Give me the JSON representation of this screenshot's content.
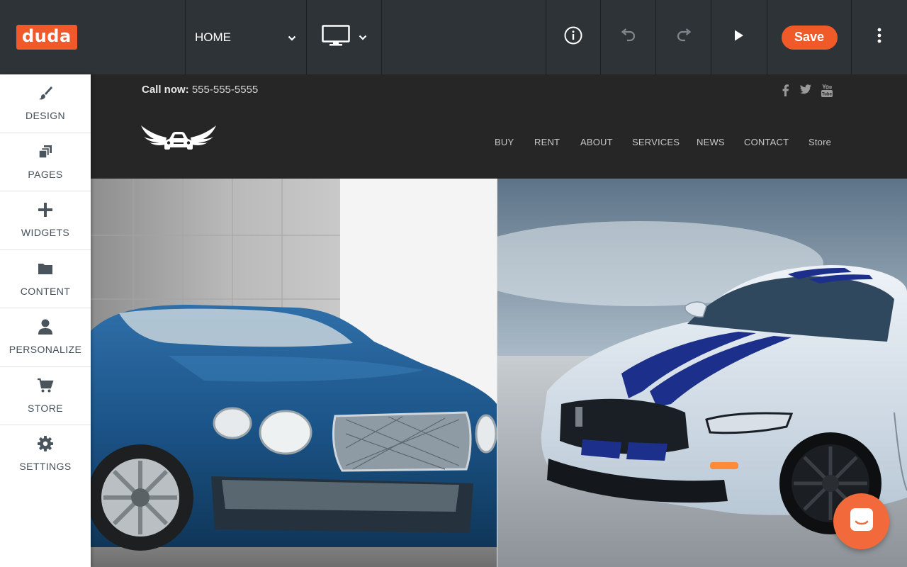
{
  "app": {
    "logo_text": "duda",
    "brand_color": "#f0592a"
  },
  "toolbar": {
    "page_select_value": "HOME",
    "device_icon": "desktop-icon",
    "info_icon": "info-icon",
    "undo_icon": "undo-icon",
    "redo_icon": "redo-icon",
    "preview_icon": "play-icon",
    "save_label": "Save",
    "more_icon": "kebab-menu-icon"
  },
  "sidebar": {
    "items": [
      {
        "label": "DESIGN",
        "icon": "brush-icon"
      },
      {
        "label": "PAGES",
        "icon": "pages-icon"
      },
      {
        "label": "WIDGETS",
        "icon": "plus-icon"
      },
      {
        "label": "CONTENT",
        "icon": "folder-icon"
      },
      {
        "label": "PERSONALIZE",
        "icon": "user-icon"
      },
      {
        "label": "STORE",
        "icon": "cart-icon"
      },
      {
        "label": "SETTINGS",
        "icon": "gear-icon"
      }
    ]
  },
  "site": {
    "call_label": "Call now:",
    "call_number": "555-555-5555",
    "social": [
      "facebook-icon",
      "twitter-icon",
      "youtube-icon"
    ],
    "nav": [
      "BUY",
      "RENT",
      "ABOUT",
      "SERVICES",
      "NEWS",
      "CONTACT",
      "Store"
    ],
    "hero_left": "blue-luxury-car-image",
    "hero_right": "white-sports-car-image"
  },
  "chat": {
    "icon": "chat-icon",
    "color": "#f26a3c"
  }
}
